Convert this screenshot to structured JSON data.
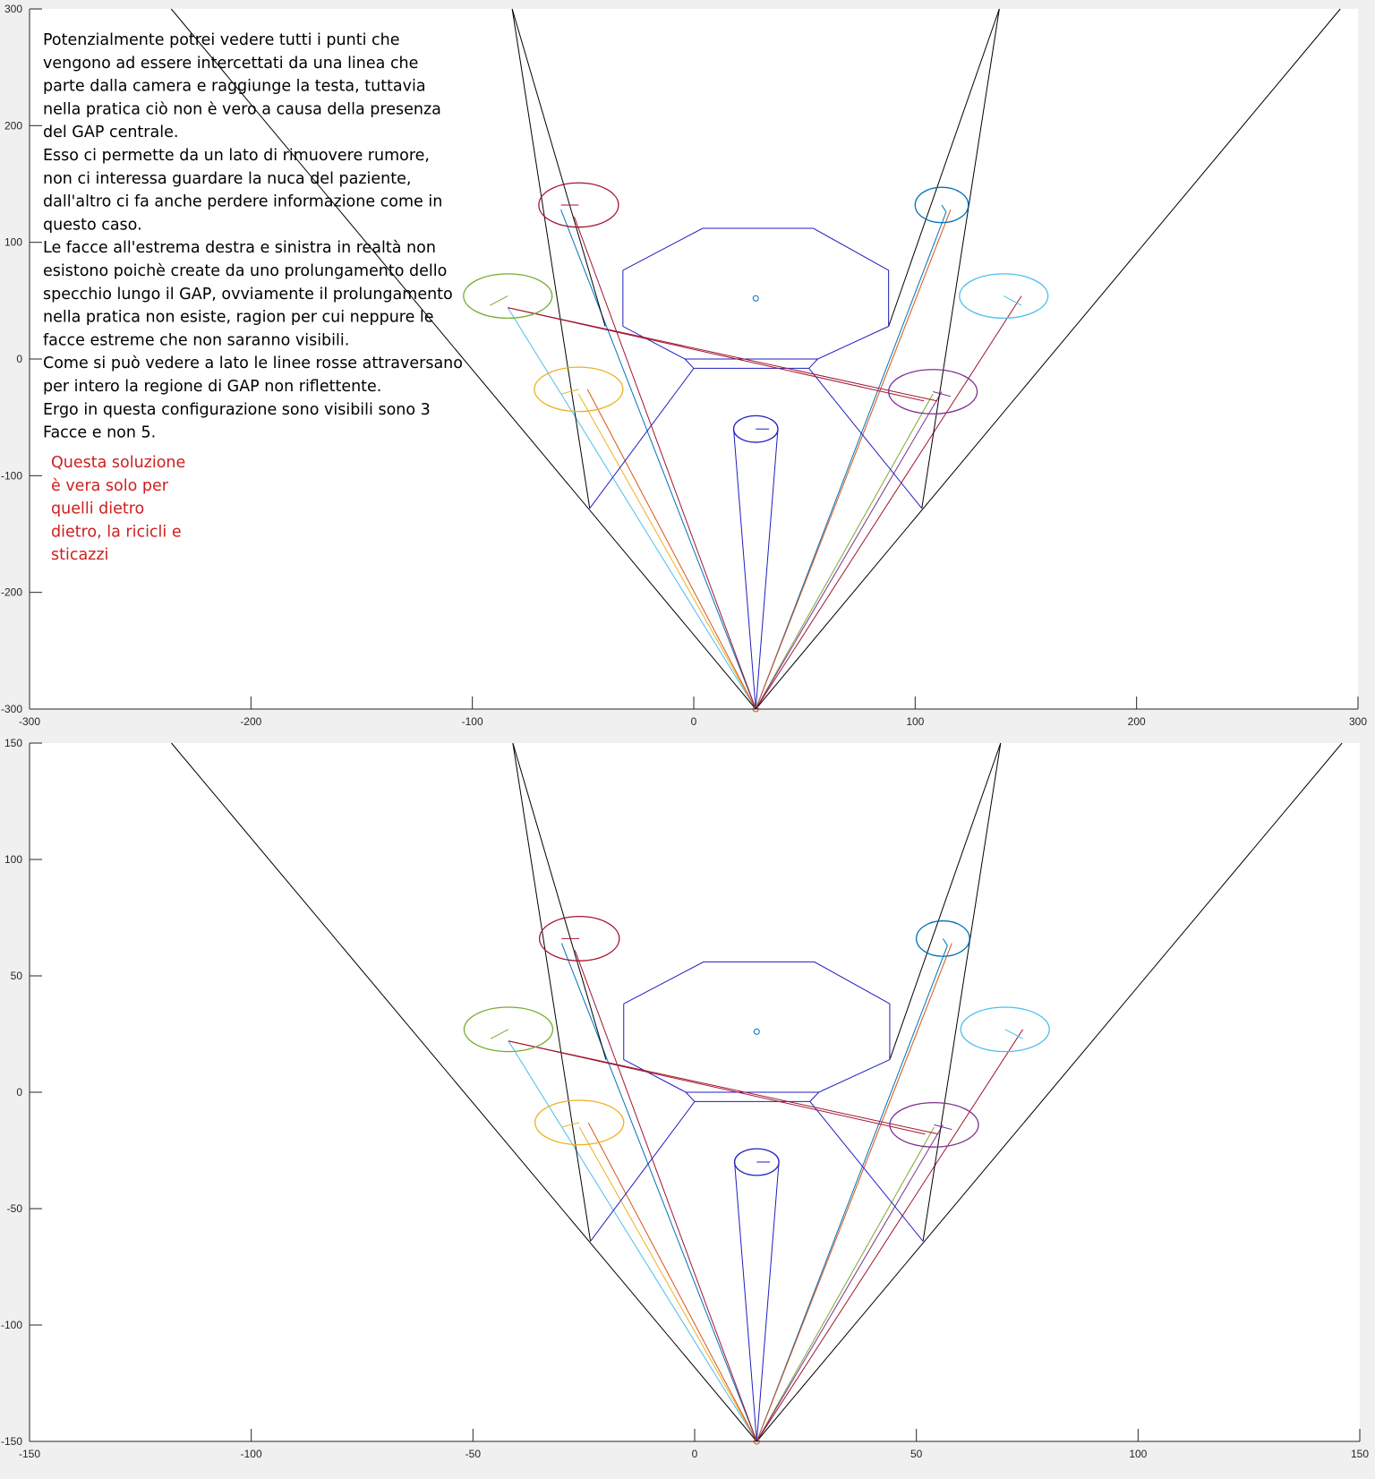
{
  "chart_data": [
    {
      "type": "line",
      "title": "",
      "xlabel": "",
      "ylabel": "",
      "xlim": [
        -300,
        300
      ],
      "ylim": [
        -300,
        300
      ],
      "xticks": [
        "-300",
        "-200",
        "-100",
        "0",
        "100",
        "200",
        "300"
      ],
      "yticks": [
        "300",
        "200",
        "100",
        "0",
        "-100",
        "-200",
        "-300"
      ],
      "xtick_values": [
        -300,
        -200,
        -100,
        0,
        100,
        200,
        300
      ],
      "ytick_values": [
        300,
        200,
        100,
        0,
        -100,
        -200,
        -300
      ],
      "grid": false,
      "annotation_lines": [
        "Potenzialmente potrei vedere tutti i punti che",
        "vengono ad essere intercettati da una linea che",
        "parte dalla camera e raggiunge la testa, tuttavia",
        "nella pratica ciò non è vero a causa della presenza",
        "del GAP centrale.",
        "Esso ci permette da un lato di rimuovere rumore,",
        "non ci interessa guardare la nuca del paziente,",
        "dall'altro ci fa anche perdere informazione come in",
        "questo caso.",
        "Le facce all'estrema destra e sinistra in realtà non",
        "esistono poichè create da uno prolungamento dello",
        "specchio lungo il GAP, ovviamente il prolungamento",
        "nella pratica non esiste, ragion per cui neppure le",
        "facce estreme che non saranno visibili.",
        "Come si può vedere a lato le linee rosse attraversano",
        "per intero la regione di GAP non riflettente.",
        "Ergo in questa configurazione sono visibili sono 3",
        "Facce e non 5."
      ],
      "annotation_red_lines": [
        "Questa soluzione",
        "è vera solo per",
        "quelli dietro",
        "dietro, la ricicli e",
        "sticazzi"
      ]
    },
    {
      "type": "line",
      "title": "",
      "xlabel": "",
      "ylabel": "",
      "xlim": [
        -150,
        150
      ],
      "ylim": [
        -150,
        150
      ],
      "xticks": [
        "-150",
        "-100",
        "-50",
        "0",
        "50",
        "100",
        "150"
      ],
      "yticks": [
        "150",
        "100",
        "50",
        "0",
        "-50",
        "-100",
        "-150"
      ],
      "xtick_values": [
        -150,
        -100,
        -50,
        0,
        50,
        100,
        150
      ],
      "ytick_values": [
        150,
        100,
        50,
        0,
        -50,
        -100,
        -150
      ],
      "grid": false
    }
  ],
  "scene": {
    "camera": [
      14,
      -150
    ],
    "colors": {
      "outer": "#000000",
      "mirror": "#1f1fbf",
      "red_cross": "#a2142f",
      "blue": "#0072bd",
      "orange": "#d95319",
      "yellow": "#edb120",
      "purple": "#7e2f8e",
      "green": "#77ac30",
      "cyan": "#4dbeee",
      "maroon": "#a2142f"
    },
    "outer_lines": [
      [
        [
          14,
          -150
        ],
        [
          -118,
          150
        ]
      ],
      [
        [
          14,
          -150
        ],
        [
          146,
          150
        ]
      ],
      [
        [
          -20,
          14
        ],
        [
          -41,
          150
        ]
      ],
      [
        [
          44,
          14
        ],
        [
          69,
          150
        ]
      ]
    ],
    "inner_cone": [
      [
        [
          -23.5,
          -64
        ],
        [
          -41,
          150
        ]
      ],
      [
        [
          51.5,
          -64
        ],
        [
          69,
          150
        ]
      ]
    ],
    "octagon": [
      [
        -16,
        38
      ],
      [
        2,
        56
      ],
      [
        27,
        56
      ],
      [
        44,
        38
      ],
      [
        44,
        14
      ],
      [
        28,
        0
      ],
      [
        -2,
        0
      ],
      [
        -16,
        14
      ],
      [
        -16,
        38
      ]
    ],
    "mirror_bar": [
      [
        -2,
        0
      ],
      [
        28,
        0
      ],
      [
        26,
        -4
      ],
      [
        0,
        -4
      ],
      [
        -2,
        0
      ]
    ],
    "mirror_wings": [
      [
        [
          0,
          -4
        ],
        [
          -23.5,
          -64
        ]
      ],
      [
        [
          26,
          -4
        ],
        [
          51.5,
          -64
        ]
      ]
    ],
    "head_center": [
      14,
      26
    ],
    "red_cross": [
      [
        [
          -42,
          22
        ],
        [
          52,
          -18
        ]
      ],
      [
        [
          -42,
          22
        ],
        [
          55,
          -18
        ]
      ]
    ],
    "heads": [
      {
        "name": "maroon",
        "c": [
          -26,
          66
        ],
        "rx": 9,
        "ry": 5,
        "ray_to": [
          -30,
          66
        ]
      },
      {
        "name": "blue",
        "c": [
          56,
          66
        ],
        "rx": 6,
        "ry": 4,
        "ray_to": [
          57,
          63
        ]
      },
      {
        "name": "green",
        "c": [
          -42,
          27
        ],
        "rx": 10,
        "ry": 5,
        "ray_to": [
          -46,
          23
        ]
      },
      {
        "name": "cyan",
        "c": [
          70,
          27
        ],
        "rx": 10,
        "ry": 5,
        "ray_to": [
          74,
          23
        ]
      },
      {
        "name": "yellow",
        "c": [
          -26,
          -13
        ],
        "rx": 10,
        "ry": 5,
        "ray_to": [
          -30,
          -15
        ]
      },
      {
        "name": "purple",
        "c": [
          54,
          -14
        ],
        "rx": 10,
        "ry": 5,
        "ray_to": [
          58,
          -16
        ]
      }
    ],
    "cone": {
      "top_c": [
        14,
        -30
      ],
      "rx": 5,
      "ry": 3,
      "apex": [
        14,
        -150
      ]
    }
  }
}
